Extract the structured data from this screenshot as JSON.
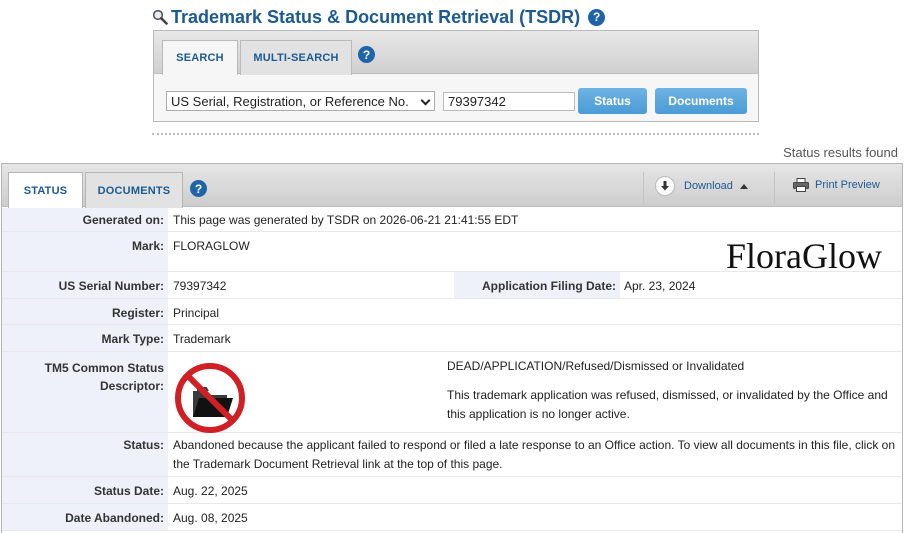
{
  "header": {
    "title": "Trademark Status & Document Retrieval (TSDR)"
  },
  "search": {
    "tabs": [
      "SEARCH",
      "MULTI-SEARCH"
    ],
    "type_selected": "US Serial, Registration, or Reference No.",
    "number_value": "79397342",
    "status_button": "Status",
    "documents_button": "Documents"
  },
  "results_found": "Status results found",
  "panel": {
    "tabs": [
      "STATUS",
      "DOCUMENTS"
    ],
    "download_label": "Download",
    "print_preview_label": "Print Preview"
  },
  "record": {
    "generated_on": {
      "label": "Generated on:",
      "value": "This page was generated by TSDR on 2026-06-21 21:41:55 EDT"
    },
    "mark": {
      "label": "Mark:",
      "value": "FLORAGLOW",
      "image_text": "FloraGlow"
    },
    "serial": {
      "label": "US Serial Number:",
      "value": "79397342"
    },
    "filing_date": {
      "label": "Application Filing Date:",
      "value": "Apr. 23, 2024"
    },
    "register": {
      "label": "Register:",
      "value": "Principal"
    },
    "mark_type": {
      "label": "Mark Type:",
      "value": "Trademark"
    },
    "tm5": {
      "label_line1": "TM5 Common Status",
      "label_line2": "Descriptor:",
      "status_title": "DEAD/APPLICATION/Refused/Dismissed or Invalidated",
      "status_desc_line1": "This trademark application was refused, dismissed, or invalidated by the Office and",
      "status_desc_line2": "this application is no longer active."
    },
    "status": {
      "label": "Status:",
      "line1": "Abandoned because the applicant failed to respond or filed a late response to an Office action. To view all documents in this file, click on",
      "line2": "the Trademark Document Retrieval link at the top of this page."
    },
    "status_date": {
      "label": "Status Date:",
      "value": "Aug. 22, 2025"
    },
    "date_abandoned": {
      "label": "Date Abandoned:",
      "value": "Aug. 08, 2025"
    }
  },
  "colors": {
    "title_blue": "#1b5a92",
    "button_blue": "#4a9bd6",
    "label_bg": "#eef1fa",
    "dead_red": "#d11f26"
  },
  "icons": [
    "magnifier-icon",
    "help-icon",
    "download-icon",
    "printer-icon",
    "dead-folder-icon"
  ]
}
